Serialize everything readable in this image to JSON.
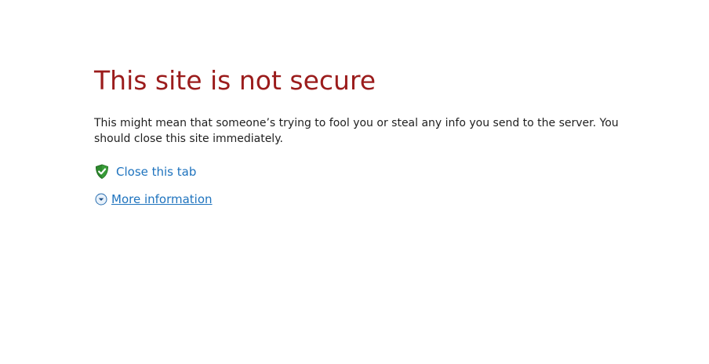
{
  "error": {
    "title": "This site is not secure",
    "message": "This might mean that someone’s trying to fool you or steal any info you send to the server. You should close this site immediately."
  },
  "actions": {
    "close_tab": {
      "label": "Close this tab",
      "icon": "shield-check-icon"
    },
    "more_info": {
      "label": "More information",
      "icon": "chevron-down-circle-icon"
    }
  },
  "colors": {
    "title": "#9b1c1c",
    "link": "#1e73be",
    "shield": "#2e8b2e"
  }
}
